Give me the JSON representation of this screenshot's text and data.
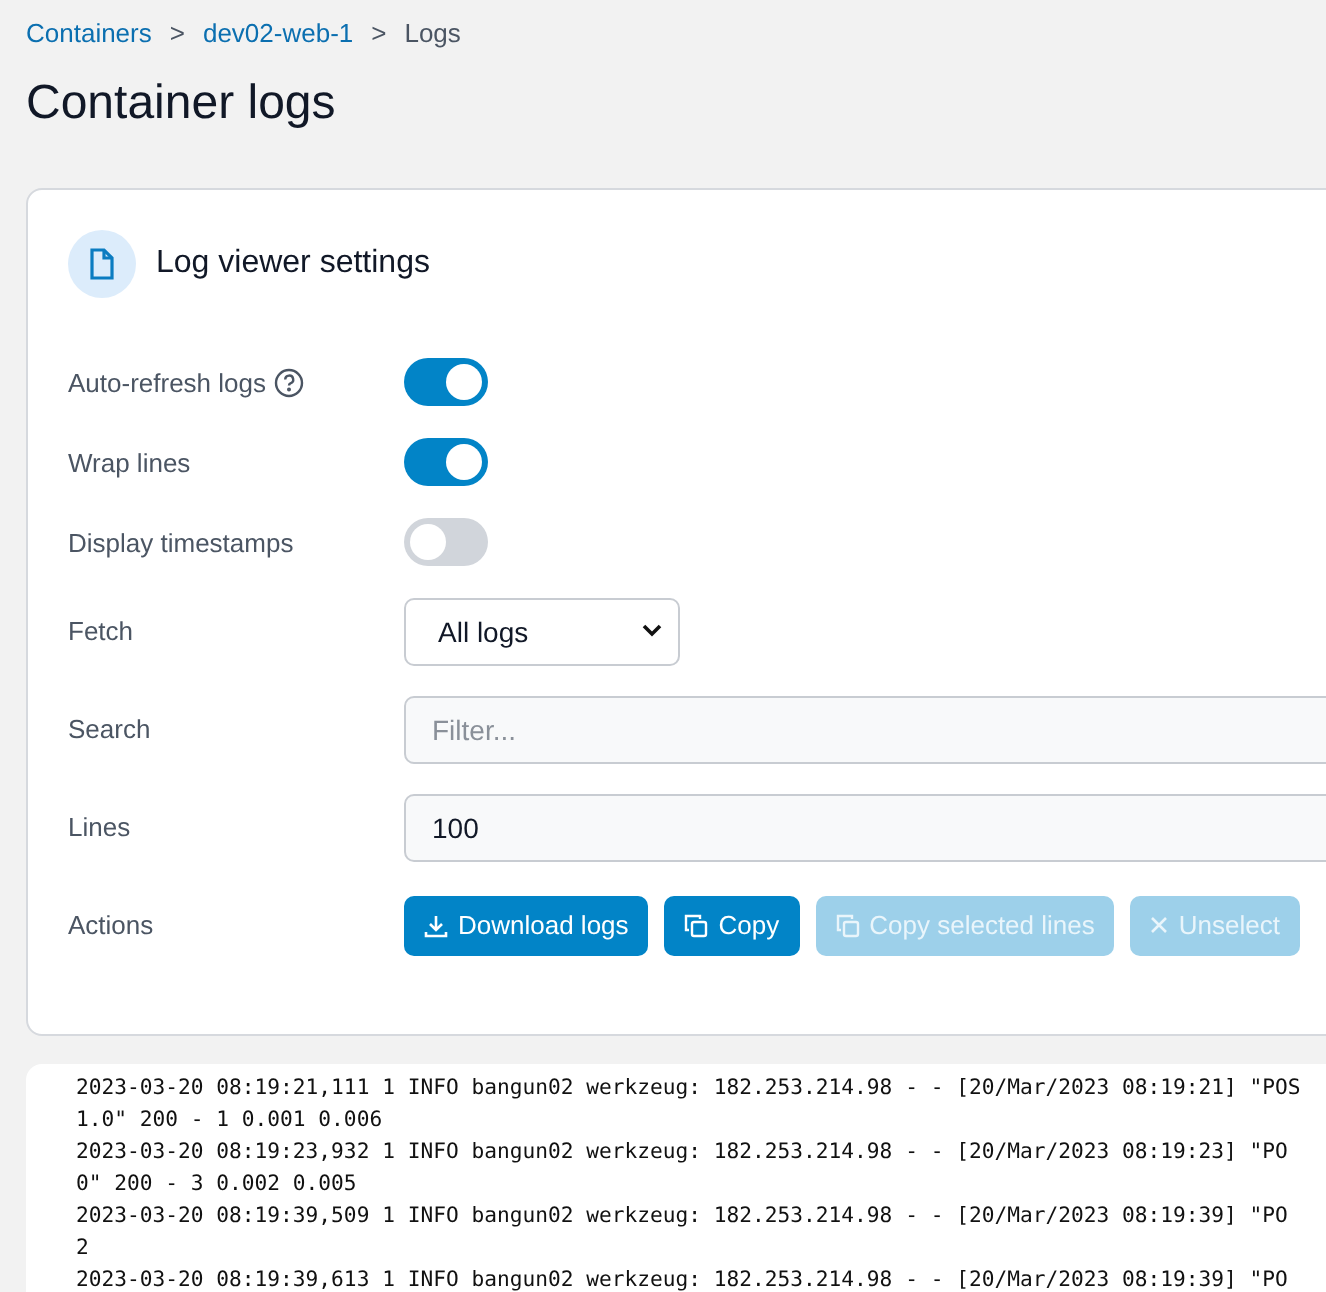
{
  "breadcrumb": [
    {
      "label": "Containers",
      "kind": "link"
    },
    {
      "label": ">",
      "kind": "separator"
    },
    {
      "label": "dev02-web-1",
      "kind": "link"
    },
    {
      "label": ">",
      "kind": "separator"
    },
    {
      "label": "Logs",
      "kind": "current"
    }
  ],
  "title": "Container logs",
  "settings": {
    "title": "Log viewer settings",
    "rows": [
      {
        "kind": "toggle",
        "label": "Auto-refresh logs",
        "help": true,
        "on": true
      },
      {
        "kind": "toggle",
        "label": "Wrap lines",
        "help": false,
        "on": true
      },
      {
        "kind": "toggle",
        "label": "Display timestamps",
        "help": false,
        "on": false
      },
      {
        "kind": "select",
        "label": "Fetch",
        "value": "All logs"
      },
      {
        "kind": "input",
        "label": "Search",
        "placeholder": "Filter..."
      },
      {
        "kind": "input",
        "label": "Lines",
        "value": "100"
      },
      {
        "kind": "actions",
        "label": "Actions",
        "buttons": [
          {
            "label": "Download logs",
            "kind": "download",
            "disabled": false
          },
          {
            "label": "Copy",
            "kind": "copy",
            "disabled": false
          },
          {
            "label": "Copy selected lines",
            "kind": "copy",
            "disabled": true
          },
          {
            "label": "Unselect",
            "kind": "clear",
            "disabled": true
          }
        ]
      }
    ]
  },
  "log_lines": [
    "2023-03-20 08:19:21,111 1 INFO bangun02 werkzeug: 182.253.214.98 - - [20/Mar/2023 08:19:21] \"POS",
    "1.0\" 200 - 1 0.001 0.006",
    "2023-03-20 08:19:23,932 1 INFO bangun02 werkzeug: 182.253.214.98 - - [20/Mar/2023 08:19:23] \"PO",
    "0\" 200 - 3 0.002 0.005",
    "2023-03-20 08:19:39,509 1 INFO bangun02 werkzeug: 182.253.214.98 - - [20/Mar/2023 08:19:39] \"PO",
    "2",
    "2023-03-20 08:19:39,613 1 INFO bangun02 werkzeug: 182.253.214.98 - - [20/Mar/2023 08:19:39] \"PO"
  ]
}
